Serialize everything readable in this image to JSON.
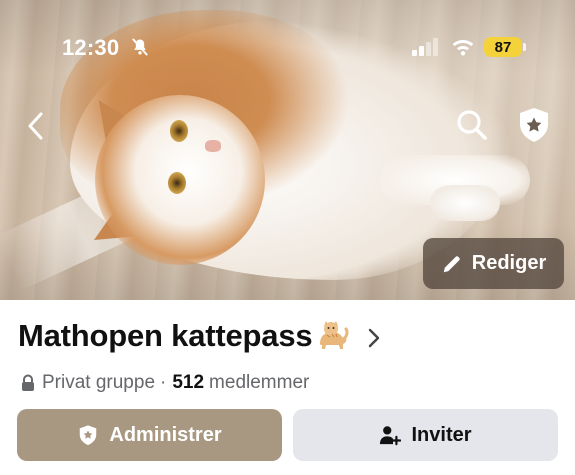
{
  "status_bar": {
    "time": "12:30",
    "battery_level": "87",
    "icons": [
      "bell-slash-icon",
      "signal-icon",
      "wifi-icon",
      "battery-icon"
    ],
    "battery_color": "#f4d23a"
  },
  "cover": {
    "icons": [
      "back-chevron-icon",
      "search-icon",
      "admin-shield-icon"
    ],
    "edit_label": "Rediger"
  },
  "group": {
    "name": "Mathopen kattepass",
    "emoji_icon": "cat-emoji-icon",
    "privacy": "Privat gruppe",
    "separator": "·",
    "member_count": "512",
    "member_label": "medlemmer"
  },
  "actions": {
    "admin_label": "Administrer",
    "invite_label": "Inviter",
    "admin_color": "#a89881",
    "invite_color": "#e4e6eb"
  }
}
